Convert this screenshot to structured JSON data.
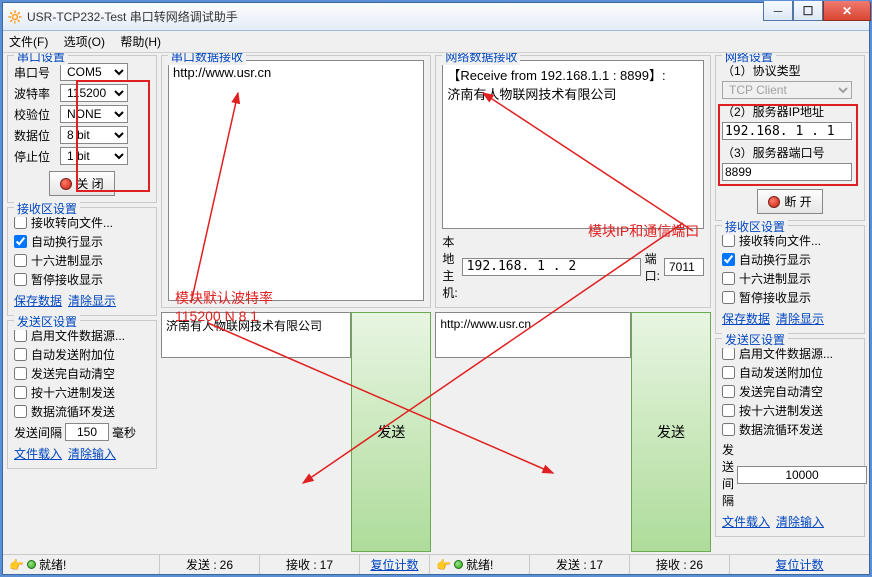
{
  "window": {
    "title": "USR-TCP232-Test 串口转网络调试助手",
    "menu": {
      "file": "文件(F)",
      "options": "选项(O)",
      "help": "帮助(H)"
    }
  },
  "serial": {
    "group": "串口设置",
    "labels": {
      "port": "串口号",
      "baud": "波特率",
      "parity": "校验位",
      "data": "数据位",
      "stop": "停止位"
    },
    "values": {
      "port": "COM5",
      "baud": "115200",
      "parity": "NONE",
      "data": "8 bit",
      "stop": "1 bit"
    },
    "close_btn": "关 闭"
  },
  "recv": {
    "group": "接收区设置",
    "to_file": "接收转向文件...",
    "auto_wrap": "自动换行显示",
    "hex": "十六进制显示",
    "pause": "暂停接收显示",
    "save": "保存数据",
    "clear": "清除显示"
  },
  "send": {
    "group": "发送区设置",
    "from_file": "启用文件数据源...",
    "auto_append": "自动发送附加位",
    "clear_after": "发送完自动清空",
    "hex": "按十六进制发送",
    "loop": "数据流循环发送",
    "interval_label": "发送间隔",
    "interval_left": "150",
    "interval_right": "10000",
    "interval_unit": "毫秒",
    "load_file": "文件载入",
    "clear_input": "清除输入"
  },
  "serial_recv": {
    "group": "串口数据接收",
    "text": "http://www.usr.cn"
  },
  "net_recv": {
    "group": "网络数据接收",
    "text": "【Receive from 192.168.1.1 : 8899】:\n济南有人物联网技术有限公司"
  },
  "serial_send_text": "济南有人物联网技术有限公司",
  "net_send_text": "http://www.usr.cn",
  "send_btn": "发送",
  "localhost": {
    "label": "本地主机:",
    "ip": "192.168. 1 . 2",
    "port_label": "端口:",
    "port": "7011"
  },
  "net": {
    "group": "网络设置",
    "proto_label": "（1）协议类型",
    "proto": "TCP Client",
    "ip_label": "（2）服务器IP地址",
    "ip": "192.168. 1 . 1",
    "port_label": "（3）服务器端口号",
    "port": "8899",
    "disconnect_btn": "断 开"
  },
  "status": {
    "ready": "就绪!",
    "send_label": "发送 :",
    "send_count": "26",
    "recv_label": "接收 :",
    "recv_count": "17",
    "recv_count2": "26",
    "reset": "复位计数"
  },
  "annot": {
    "baud": "模块默认波特率\n115200 N 8 1",
    "ipport": "模块IP和通信端口"
  }
}
